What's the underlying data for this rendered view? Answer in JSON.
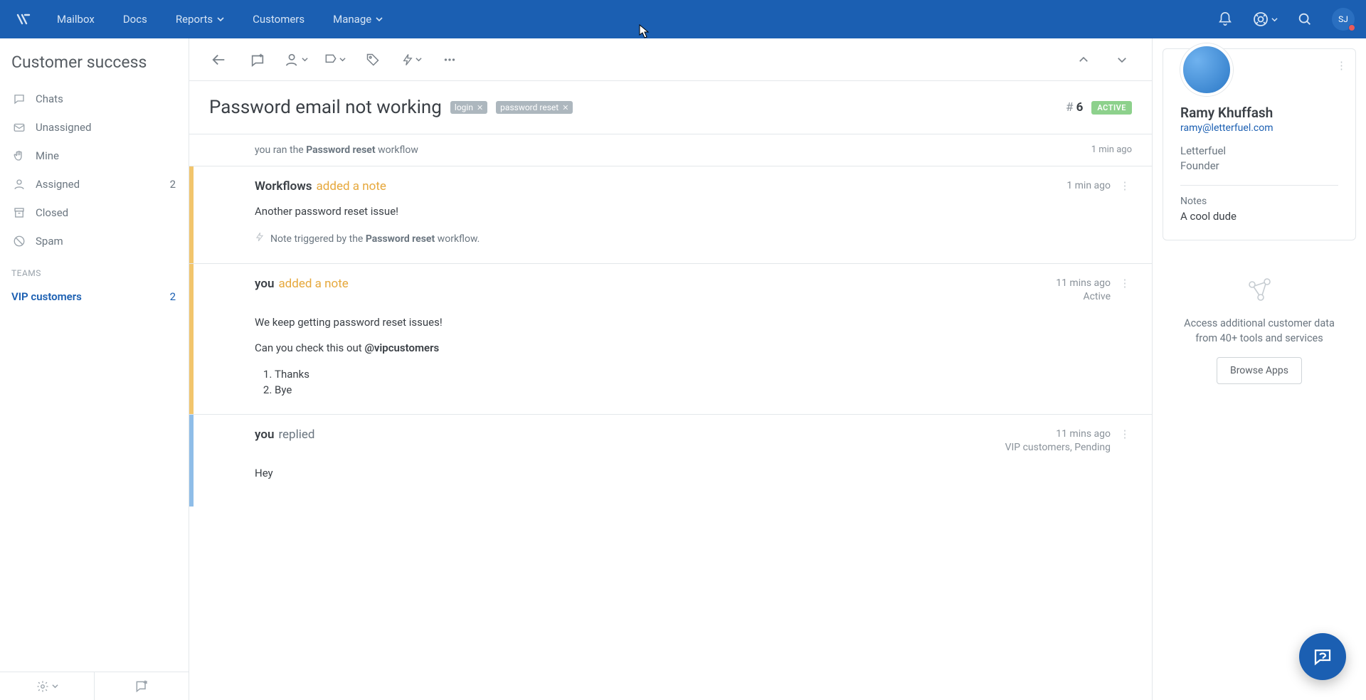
{
  "nav": {
    "links": [
      "Mailbox",
      "Docs",
      "Reports",
      "Customers",
      "Manage"
    ],
    "avatar_initials": "SJ"
  },
  "sidebar": {
    "title": "Customer success",
    "folders": [
      {
        "label": "Chats"
      },
      {
        "label": "Unassigned"
      },
      {
        "label": "Mine"
      },
      {
        "label": "Assigned",
        "count": "2"
      },
      {
        "label": "Closed"
      },
      {
        "label": "Spam"
      }
    ],
    "teams_label": "TEAMS",
    "team": {
      "label": "VIP customers",
      "count": "2"
    }
  },
  "conversation": {
    "subject": "Password email not working",
    "tags": [
      "login",
      "password reset"
    ],
    "number_prefix": "#",
    "number": "6",
    "status": "ACTIVE",
    "system_event": {
      "prefix": "you ran the ",
      "bold": "Password reset",
      "suffix": " workflow",
      "time": "1 min ago"
    },
    "events": [
      {
        "kind": "yellow",
        "who": "Workflows",
        "verb": "added a note",
        "time": "1 min ago",
        "meta2": "",
        "body_plain": "Another password reset issue!",
        "trigger": {
          "prefix": "Note triggered by the ",
          "bold": "Password reset",
          "suffix": " workflow."
        }
      },
      {
        "kind": "yellow",
        "who": "you",
        "verb": "added a note",
        "time": "11 mins ago",
        "meta2": "Active",
        "body_p1": "We keep getting password reset issues!",
        "body_p2_before": "Can you check this out ",
        "body_p2_mention": "@vipcustomers",
        "list": [
          "Thanks",
          "Bye"
        ]
      },
      {
        "kind": "blue",
        "who": "you",
        "verb": "replied",
        "time": "11 mins ago",
        "meta2": "VIP customers, Pending",
        "body_plain": "Hey"
      }
    ]
  },
  "customer": {
    "name": "Ramy Khuffash",
    "email": "ramy@letterfuel.com",
    "company": "Letterfuel",
    "title": "Founder",
    "notes_label": "Notes",
    "notes": "A cool dude"
  },
  "apps": {
    "line1": "Access additional customer data",
    "line2": "from 40+ tools and services",
    "button": "Browse Apps"
  }
}
